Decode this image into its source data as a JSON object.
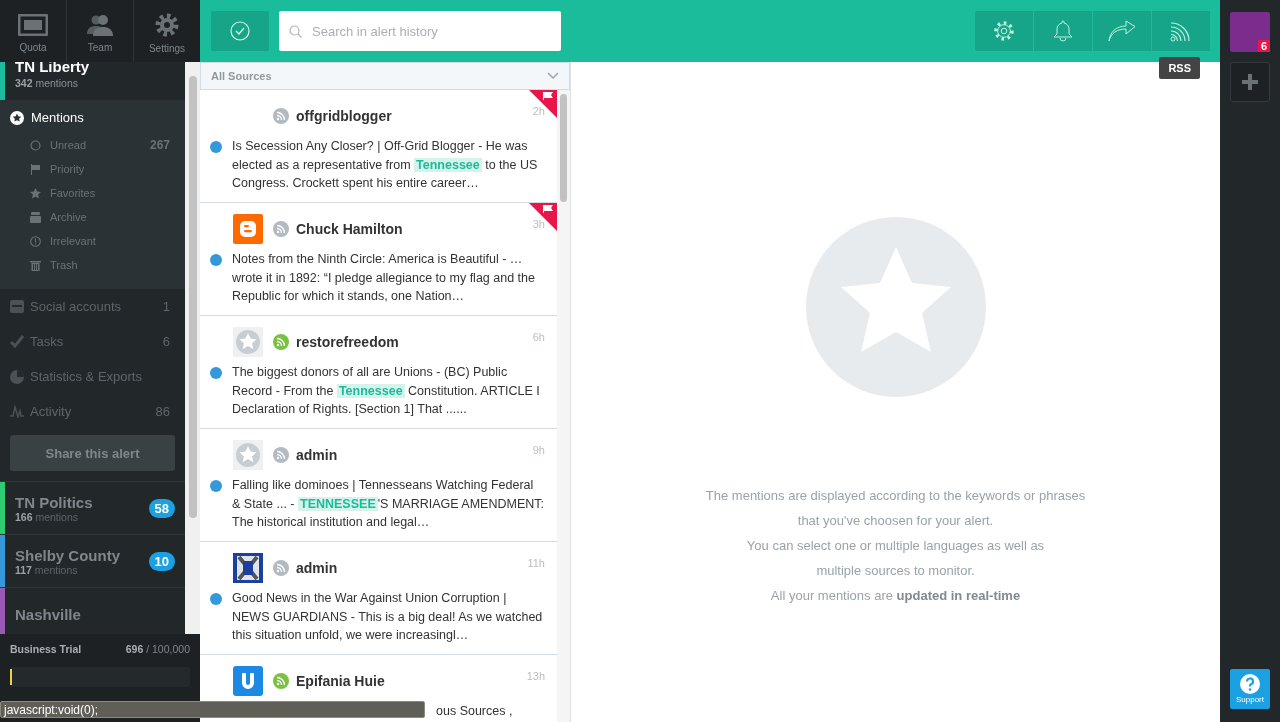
{
  "nav": [
    {
      "label": "Quota"
    },
    {
      "label": "Team"
    },
    {
      "label": "Settings"
    }
  ],
  "current_alert": {
    "name": "TN Liberty",
    "count": "342",
    "count_label": "mentions"
  },
  "mentions": {
    "label": "Mentions",
    "expanded": true,
    "items": [
      {
        "label": "Unread",
        "count": "267"
      },
      {
        "label": "Priority"
      },
      {
        "label": "Favorites"
      },
      {
        "label": "Archive"
      },
      {
        "label": "Irrelevant"
      },
      {
        "label": "Trash"
      }
    ]
  },
  "menu": [
    {
      "label": "Social accounts",
      "count": "1"
    },
    {
      "label": "Tasks",
      "count": "6"
    },
    {
      "label": "Statistics & Exports"
    },
    {
      "label": "Activity",
      "count": "86"
    }
  ],
  "share_button": "Share this alert",
  "alerts": [
    {
      "name": "TN Politics",
      "count": "166",
      "count_label": "mentions",
      "badge": "58",
      "color": "#2ecc71"
    },
    {
      "name": "Shelby County",
      "count": "117",
      "count_label": "mentions",
      "badge": "10",
      "color": "#3498db"
    },
    {
      "name": "Nashville",
      "color": "#9b59b6"
    }
  ],
  "trial": {
    "plan": "Business Trial",
    "used": "696",
    "limit": "/ 100,000",
    "level": 0.007
  },
  "toolbar": {
    "search": {
      "placeholder": "Search in alert history"
    },
    "tooltip": "RSS"
  },
  "source_filter": "All Sources",
  "mentions_list": [
    {
      "kind": "none",
      "feed": {
        "color": "#b4bac2"
      },
      "author": "offgridblogger",
      "time": "2h",
      "flagged": true,
      "unread": true,
      "text": "Is Secession Any Closer? | Off-Grid Blogger - He was elected as a representative from **Tennessee** to the US Congress. Crockett spent his entire career…"
    },
    {
      "kind": "blogger",
      "feed": {
        "color": "#b4bac2"
      },
      "author": "Chuck Hamilton",
      "time": "3h",
      "flagged": true,
      "unread": true,
      "text": "Notes from the Ninth Circle: America is Beautiful - … wrote it in 1892: “I pledge allegiance to my flag and the Republic for which it stands, one Nation…"
    },
    {
      "kind": "star",
      "feed": {
        "color": "#7ac143"
      },
      "author": "restorefreedom",
      "time": "6h",
      "flagged": false,
      "unread": true,
      "text": "The biggest donors of all are Unions - (BC) Public Record - From the **Tennessee** Constitution. ARTICLE I Declaration of Rights. [Section 1] That ......"
    },
    {
      "kind": "star",
      "feed": {
        "color": "#b4bac2"
      },
      "author": "admin",
      "time": "9h",
      "flagged": false,
      "unread": true,
      "text": "Falling like dominoes | Tennesseans Watching Federal & State ... - **TENNESSEE**'S MARRIAGE AMENDMENT: The historical institution and legal…"
    },
    {
      "kind": "logo",
      "feed": {
        "color": "#b4bac2"
      },
      "author": "admin",
      "time": "11h",
      "flagged": false,
      "unread": true,
      "text": "Good News in the War Against Union Corruption | NEWS GUARDIANS - This is a big deal! As we watched this situation unfold, we were increasingl…"
    },
    {
      "kind": "letter",
      "feed": {
        "color": "#7ac143"
      },
      "author": "Epifania Huie",
      "time": "13h",
      "flagged": false,
      "text": "ous Sources ,"
    }
  ],
  "empty_state": {
    "lines": [
      "The mentions are displayed according to the keywords or phrases",
      "that you've choosen for your alert.",
      "You can select one or multiple languages as well as",
      "multiple sources to monitor.",
      "All your mentions are **updated in real-time**"
    ]
  },
  "notifications_badge": "6",
  "support": "Support",
  "status_bar": "javascript:void(0);"
}
